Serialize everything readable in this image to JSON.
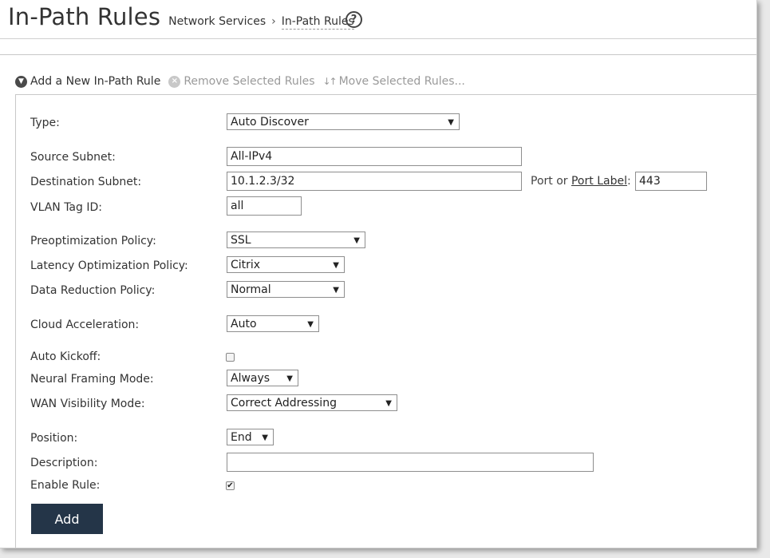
{
  "header": {
    "title": "In-Path Rules",
    "breadcrumb": {
      "parent": "Network Services",
      "separator": "›",
      "current": "In-Path Rules"
    },
    "help_glyph": "?"
  },
  "toolbar": {
    "add_label": "Add a New In-Path Rule",
    "remove_label": "Remove Selected Rules",
    "move_label": "Move Selected Rules..."
  },
  "form": {
    "type": {
      "label": "Type:",
      "value": "Auto Discover"
    },
    "source_subnet": {
      "label": "Source Subnet:",
      "value": "All-IPv4"
    },
    "destination_subnet": {
      "label": "Destination Subnet:",
      "value": "10.1.2.3/32"
    },
    "port": {
      "prefix": "Port or ",
      "link": "Port Label",
      "suffix": ":",
      "value": "443"
    },
    "vlan_tag": {
      "label": "VLAN Tag ID:",
      "value": "all"
    },
    "preoptimization": {
      "label": "Preoptimization Policy:",
      "value": "SSL"
    },
    "latency": {
      "label": "Latency Optimization Policy:",
      "value": "Citrix"
    },
    "data_reduction": {
      "label": "Data Reduction Policy:",
      "value": "Normal"
    },
    "cloud_acceleration": {
      "label": "Cloud Acceleration:",
      "value": "Auto"
    },
    "auto_kickoff": {
      "label": "Auto Kickoff:",
      "checked": false
    },
    "neural_framing": {
      "label": "Neural Framing Mode:",
      "value": "Always"
    },
    "wan_visibility": {
      "label": "WAN Visibility Mode:",
      "value": "Correct Addressing"
    },
    "position": {
      "label": "Position:",
      "value": "End"
    },
    "description": {
      "label": "Description:",
      "value": ""
    },
    "enable_rule": {
      "label": "Enable Rule:",
      "checked": true
    },
    "add_button": "Add"
  },
  "colors": {
    "button_bg": "#243548",
    "button_text": "#ffffff",
    "text": "#333333"
  }
}
